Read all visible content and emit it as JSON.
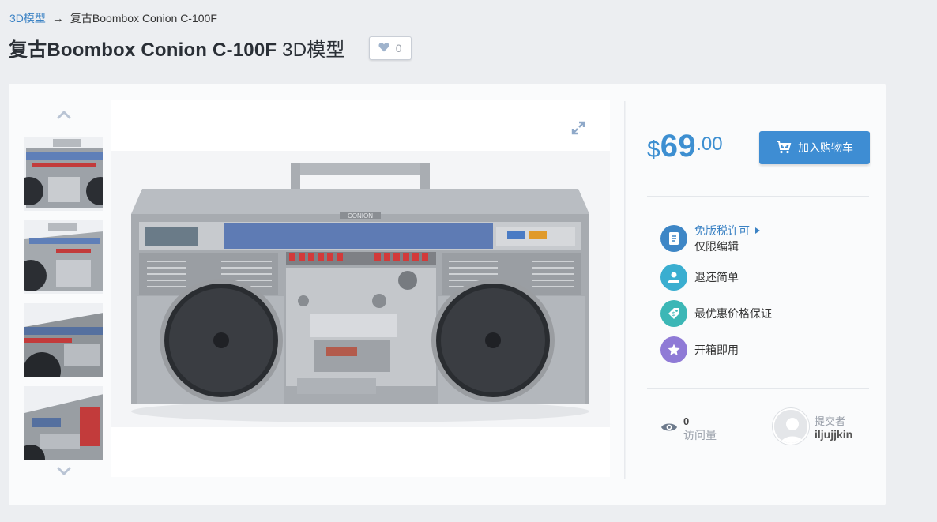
{
  "breadcrumb": {
    "root": "3D模型",
    "arrow": "→",
    "current": "复古Boombox Conion C-100F"
  },
  "title": {
    "name": "复古Boombox Conion C-100F",
    "suffix": "3D模型"
  },
  "like": {
    "count": "0",
    "icon": "heart-icon"
  },
  "gallery": {
    "thumbnails": [
      "thumbnail-1",
      "thumbnail-2",
      "thumbnail-3",
      "thumbnail-4"
    ],
    "brand_plate": "CONION"
  },
  "price": {
    "currency": "$",
    "integer": "69",
    "decimal": ".00"
  },
  "cart": {
    "label": "加入购物车"
  },
  "features": [
    {
      "label": "免版税许可",
      "sub": "仅限编辑",
      "icon": "document-icon",
      "color": "#3d86c6"
    },
    {
      "label": "退还简单",
      "icon": "refund-hand-icon",
      "color": "#3aaed0"
    },
    {
      "label": "最优惠价格保证",
      "icon": "price-tag-icon",
      "color": "#3cb7b6"
    },
    {
      "label": "开箱即用",
      "icon": "star-icon",
      "color": "#8f7ad6"
    }
  ],
  "stats": {
    "views": "0",
    "views_label": "访问量"
  },
  "author": {
    "role": "提交者",
    "name": "iljujjkin"
  },
  "colors": {
    "accent": "#3d8fd1",
    "button": "#3e8dd3",
    "background": "#eceef1"
  }
}
